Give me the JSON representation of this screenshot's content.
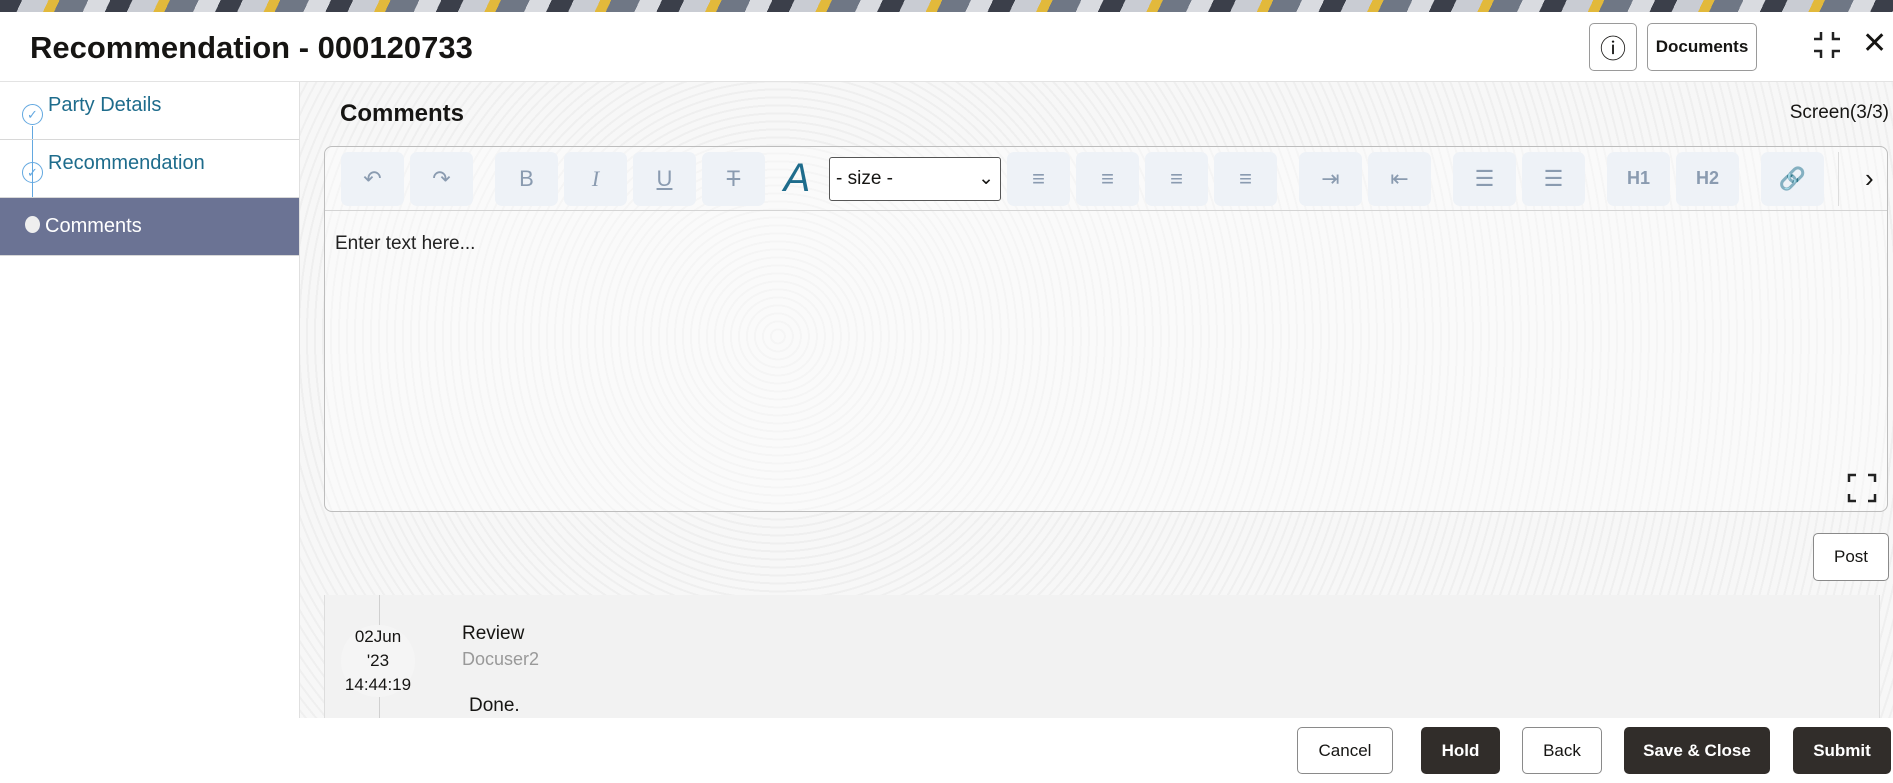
{
  "header": {
    "title": "Recommendation - 000120733",
    "info_icon": "info-icon",
    "documents_label": "Documents",
    "minimize_icon": "collapse-icon",
    "close_icon": "close-icon"
  },
  "sidebar": {
    "items": [
      {
        "label": "Party Details",
        "state": "completed"
      },
      {
        "label": "Recommendation",
        "state": "completed"
      },
      {
        "label": "Comments",
        "state": "active"
      }
    ],
    "active_color": "#6b7394"
  },
  "main": {
    "title": "Comments",
    "screen_indicator": "Screen(3/3)",
    "editor": {
      "placeholder": "Enter text here...",
      "size_select": "- size -",
      "toolbar": [
        "undo",
        "redo",
        "bold",
        "italic",
        "underline",
        "strikethrough",
        "font-color",
        "size",
        "align-left",
        "align-center",
        "align-right",
        "justify",
        "indent",
        "outdent",
        "bullet-list",
        "numbered-list",
        "H1",
        "H2",
        "link",
        "more"
      ],
      "h1": "H1",
      "h2": "H2"
    },
    "post_label": "Post",
    "comments": [
      {
        "date": "02Jun",
        "year": "'23",
        "time": "14:44:19",
        "type": "Review",
        "user": "Docuser2",
        "text": "Done."
      }
    ]
  },
  "footer": {
    "cancel": "Cancel",
    "hold": "Hold",
    "back": "Back",
    "save_close": "Save & Close",
    "submit": "Submit"
  }
}
